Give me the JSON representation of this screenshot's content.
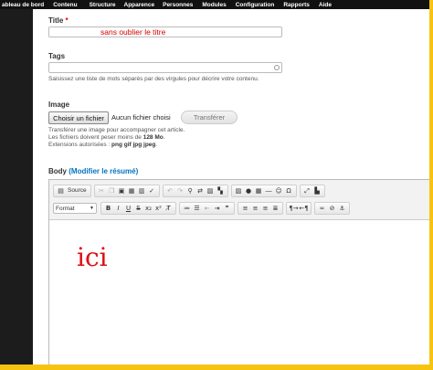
{
  "admin_bar": {
    "items": [
      "ableau de bord",
      "Contenu",
      "Structure",
      "Apparence",
      "Personnes",
      "Modules",
      "Configuration",
      "Rapports",
      "Aide"
    ]
  },
  "title_field": {
    "label": "Title",
    "required_mark": "*",
    "value": "sans oublier le titre"
  },
  "tags_field": {
    "label": "Tags",
    "value": "",
    "help": "Saisissez une liste de mots séparés par des virgules pour décrire votre contenu."
  },
  "image_field": {
    "label": "Image",
    "choose_button": "Choisir un fichier",
    "no_file": "Aucun fichier choisi",
    "upload_button": "Transférer",
    "help_line1": "Transférer une image pour accompagner cet article.",
    "help_line2_prefix": "Les fichiers doivent peser moins de ",
    "help_line2_size": "128 Mo",
    "help_line2_suffix": ".",
    "help_line3_prefix": "Extensions autorisées : ",
    "help_line3_ext": "png gif jpg jpeg",
    "help_line3_suffix": "."
  },
  "body_field": {
    "label": "Body",
    "summary_link": "(Modifier le résumé)",
    "source_button": "Source",
    "format_select": "Format",
    "content": "ici"
  },
  "colors": {
    "frame": "#f6c410",
    "admin_bar": "#111111",
    "link": "#0074bd",
    "title_value": "#d40000",
    "content_text": "#e01010"
  }
}
